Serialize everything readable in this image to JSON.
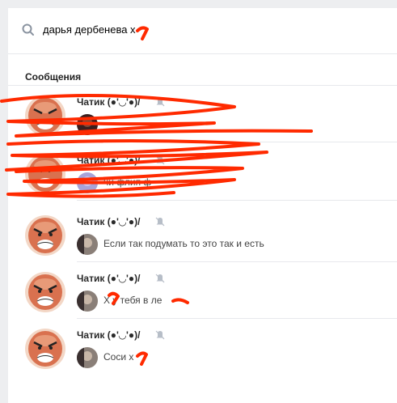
{
  "search": {
    "query": "дарья дербенева х"
  },
  "messages_section": {
    "title": "Сообщения"
  },
  "conversations": [
    {
      "name": "Чатик (●'◡'●)/",
      "preview": ""
    },
    {
      "name": "Чатик (●'◡'●)/",
      "preview": "чи флип ф"
    },
    {
      "name": "Чатик (●'◡'●)/",
      "preview": "Если так подумать то это так и есть"
    },
    {
      "name": "Чатик (●'◡'●)/",
      "preview": "Х  у тебя в  ле"
    },
    {
      "name": "Чатик (●'◡'●)/",
      "preview": "Соси х"
    }
  ],
  "colors": {
    "redaction": "#ff2a00",
    "divider": "#e7e8ec",
    "background": "#edeef0"
  },
  "icons": {
    "search": "search-icon",
    "mute": "muted-bell-icon"
  }
}
